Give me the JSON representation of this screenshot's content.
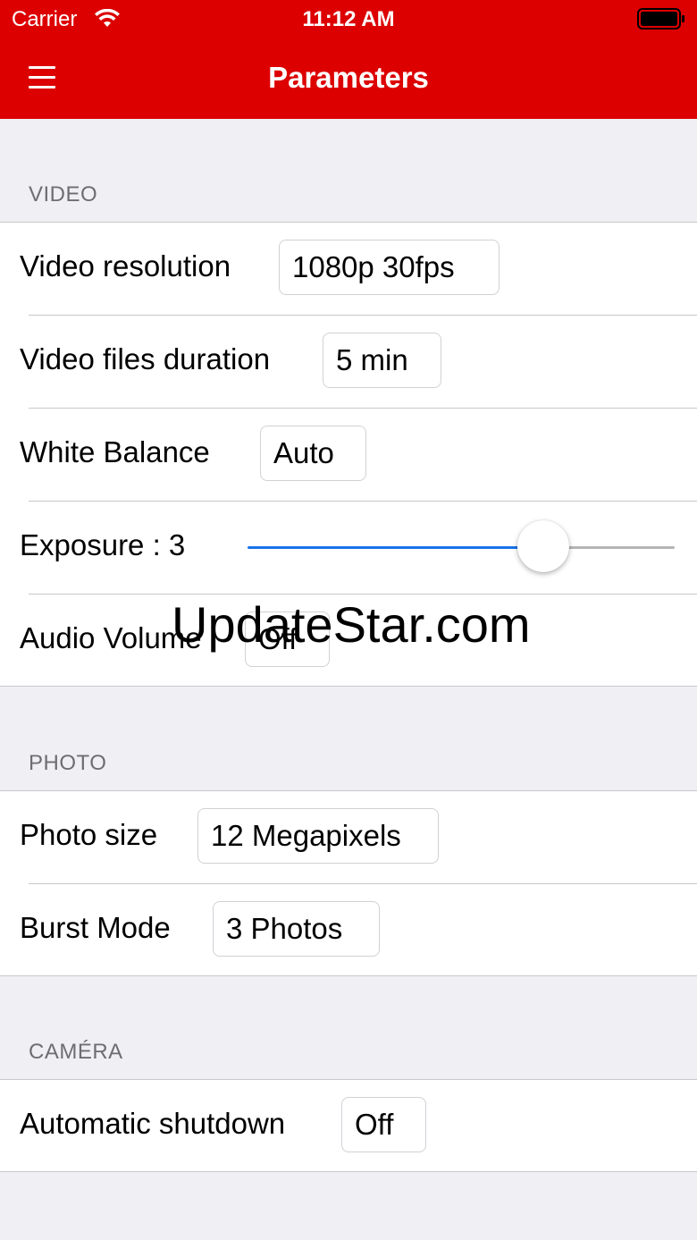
{
  "status_bar": {
    "carrier": "Carrier",
    "time": "11:12 AM",
    "wifi_icon": "wifi-icon",
    "battery_icon": "battery-icon"
  },
  "header": {
    "title": "Parameters",
    "menu_icon": "hamburger-menu-icon",
    "background_color": "#dc0000"
  },
  "sections": {
    "video": {
      "title": "VIDEO",
      "video_resolution": {
        "label": "Video resolution",
        "value": "1080p 30fps"
      },
      "video_files_duration": {
        "label": "Video files duration",
        "value": "5 min"
      },
      "white_balance": {
        "label": "White Balance",
        "value": "Auto"
      },
      "exposure": {
        "label": "Exposure : 3",
        "slider_fraction": 0.72,
        "track_color": "#1a73e8"
      },
      "audio_volume": {
        "label": "Audio Volume",
        "value": "Off"
      }
    },
    "photo": {
      "title": "PHOTO",
      "photo_size": {
        "label": "Photo size",
        "value": "12 Megapixels"
      },
      "burst_mode": {
        "label": "Burst Mode",
        "value": "3 Photos"
      }
    },
    "camera": {
      "title": "CAMÉRA",
      "automatic_shutdown": {
        "label": "Automatic shutdown",
        "value": "Off"
      }
    }
  },
  "watermark": "UpdateStar.com"
}
